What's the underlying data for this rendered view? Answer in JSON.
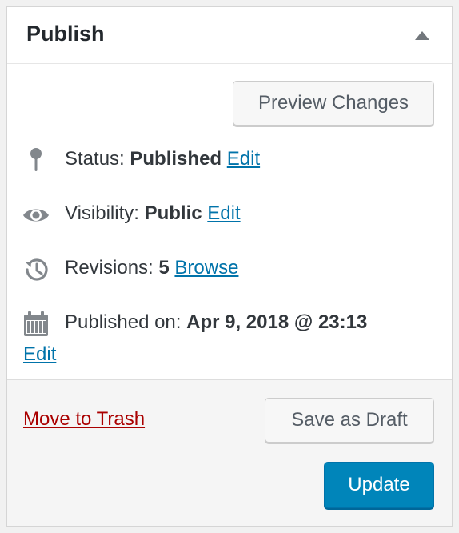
{
  "panel": {
    "title": "Publish"
  },
  "preview": {
    "label": "Preview Changes"
  },
  "status": {
    "label": "Status:",
    "value": "Published",
    "edit": "Edit",
    "icon": "pin-icon"
  },
  "visibility": {
    "label": "Visibility:",
    "value": "Public",
    "edit": "Edit",
    "icon": "eye-icon"
  },
  "revisions": {
    "label": "Revisions:",
    "value": "5",
    "browse": "Browse",
    "icon": "history-icon"
  },
  "published_on": {
    "label": "Published on:",
    "value": "Apr 9, 2018 @ 23:13",
    "edit": "Edit",
    "icon": "calendar-icon"
  },
  "footer": {
    "trash": "Move to Trash",
    "save_draft": "Save as Draft",
    "update": "Update"
  },
  "colors": {
    "link": "#0073aa",
    "trash": "#aa0000",
    "primary": "#0085ba"
  }
}
